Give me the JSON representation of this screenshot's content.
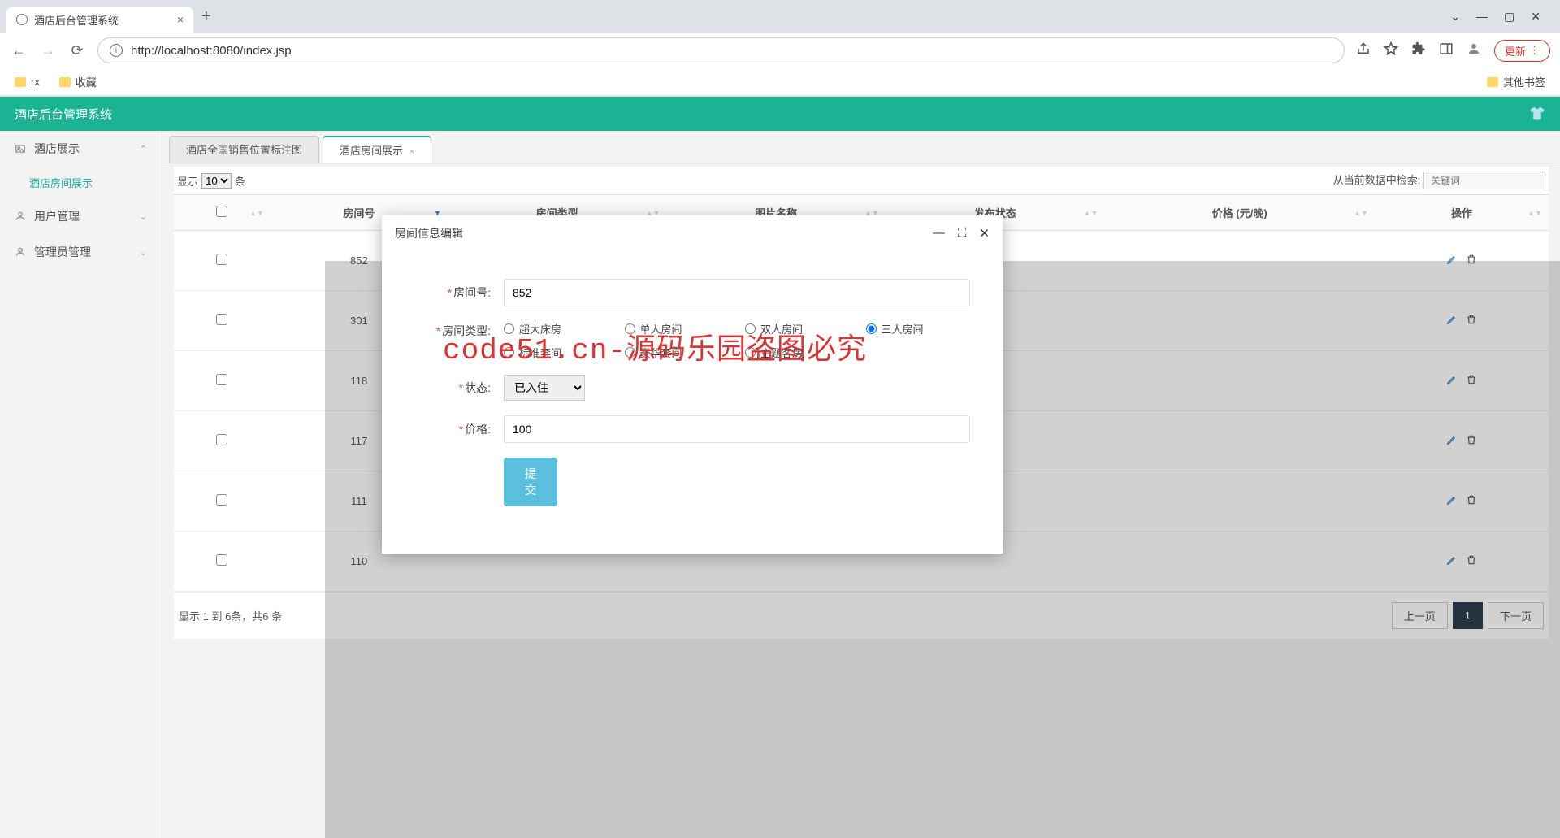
{
  "browser": {
    "tab_title": "酒店后台管理系统",
    "url": "http://localhost:8080/index.jsp",
    "update_label": "更新",
    "bookmarks": [
      "rx",
      "收藏"
    ],
    "other_bookmarks": "其他书签"
  },
  "app": {
    "title": "酒店后台管理系统"
  },
  "sidebar": {
    "items": [
      {
        "label": "酒店展示",
        "expanded": true,
        "sub": [
          "酒店房间展示"
        ]
      },
      {
        "label": "用户管理",
        "expanded": false
      },
      {
        "label": "管理员管理",
        "expanded": false
      }
    ]
  },
  "tabs": [
    {
      "label": "酒店全国销售位置标注图",
      "closable": false
    },
    {
      "label": "酒店房间展示",
      "closable": true,
      "active": true
    }
  ],
  "datatable": {
    "show_prefix": "显示",
    "show_value": "10",
    "show_suffix": "条",
    "search_label": "从当前数据中检索:",
    "search_placeholder": "关键词",
    "columns": [
      "",
      "房间号",
      "房间类型",
      "图片名称",
      "发布状态",
      "价格 (元/晚)",
      "操作"
    ],
    "rows": [
      {
        "room_no": "852"
      },
      {
        "room_no": "301"
      },
      {
        "room_no": "118"
      },
      {
        "room_no": "117"
      },
      {
        "room_no": "111"
      },
      {
        "room_no": "110"
      }
    ],
    "info": "显示 1 到 6条，共6 条",
    "prev": "上一页",
    "next": "下一页",
    "page": "1"
  },
  "modal": {
    "title": "房间信息编辑",
    "fields": {
      "room_no_label": "房间号:",
      "room_no_value": "852",
      "room_type_label": "房间类型:",
      "room_type_options": [
        "超大床房",
        "单人房间",
        "双人房间",
        "三人房间",
        "标准套间",
        "豪华套间",
        "主题客房"
      ],
      "room_type_selected": "三人房间",
      "status_label": "状态:",
      "status_value": "已入住",
      "price_label": "价格:",
      "price_value": "100",
      "submit": "提交"
    }
  },
  "watermark": "code51.cn-源码乐园盗图必究"
}
